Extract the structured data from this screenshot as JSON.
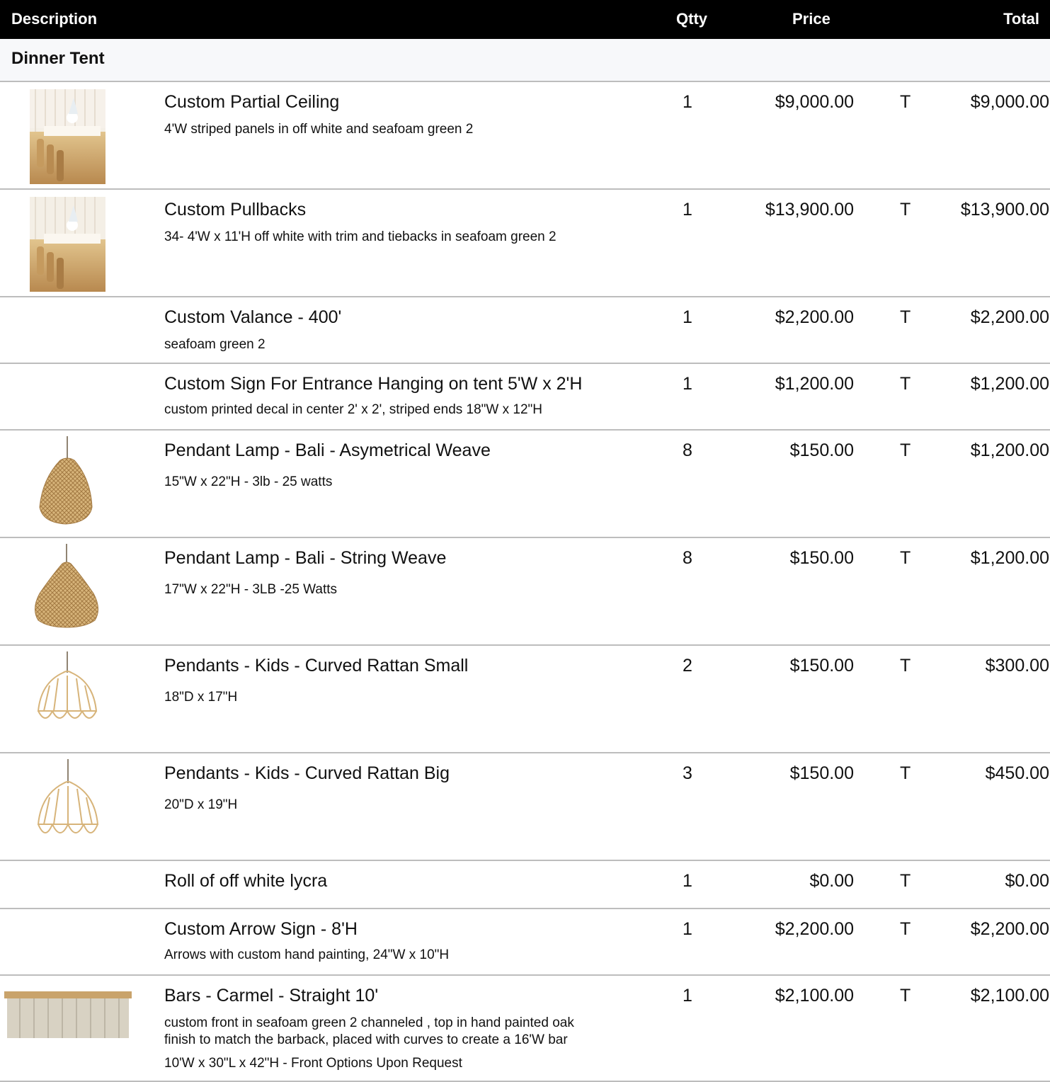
{
  "header": {
    "description": "Description",
    "qty": "Qtty",
    "price": "Price",
    "total": "Total"
  },
  "section": {
    "title": "Dinner Tent"
  },
  "rows": [
    {
      "name": "Custom Partial Ceiling",
      "details": [
        "4'W striped panels in off white and seafoam green 2"
      ],
      "qty": "1",
      "price": "$9,000.00",
      "tax": "T",
      "total": "$9,000.00",
      "image": "tent-interior-photo"
    },
    {
      "name": "Custom Pullbacks",
      "details": [
        "34- 4'W x 11'H off white with trim and tiebacks in seafoam green 2"
      ],
      "qty": "1",
      "price": "$13,900.00",
      "tax": "T",
      "total": "$13,900.00",
      "image": "tent-interior-photo"
    },
    {
      "name": "Custom Valance - 400'",
      "details": [
        "seafoam green 2"
      ],
      "qty": "1",
      "price": "$2,200.00",
      "tax": "T",
      "total": "$2,200.00"
    },
    {
      "name": "Custom Sign For Entrance Hanging on tent 5'W x 2'H",
      "details": [
        "custom printed decal in center 2' x 2', striped ends 18\"W x 12\"H"
      ],
      "qty": "1",
      "price": "$1,200.00",
      "tax": "T",
      "total": "$1,200.00"
    },
    {
      "name": "Pendant Lamp - Bali - Asymetrical Weave",
      "details": [
        "15\"W x 22\"H - 3lb - 25 watts"
      ],
      "qty": "8",
      "price": "$150.00",
      "tax": "T",
      "total": "$1,200.00",
      "image": "rattan-pendant-icon"
    },
    {
      "name": "Pendant Lamp - Bali - String Weave",
      "details": [
        "17\"W x 22\"H - 3LB -25 Watts"
      ],
      "qty": "8",
      "price": "$150.00",
      "tax": "T",
      "total": "$1,200.00",
      "image": "rattan-pendant-icon"
    },
    {
      "name": "Pendants - Kids -  Curved Rattan Small",
      "details": [
        "18\"D x 17\"H"
      ],
      "qty": "2",
      "price": "$150.00",
      "tax": "T",
      "total": "$300.00",
      "image": "scalloped-pendant-icon"
    },
    {
      "name": "Pendants - Kids -  Curved Rattan Big",
      "details": [
        "20\"D x 19\"H"
      ],
      "qty": "3",
      "price": "$150.00",
      "tax": "T",
      "total": "$450.00",
      "image": "scalloped-pendant-icon"
    },
    {
      "name": "Roll of off white lycra",
      "details": [],
      "qty": "1",
      "price": "$0.00",
      "tax": "T",
      "total": "$0.00"
    },
    {
      "name": "Custom Arrow Sign - 8'H",
      "details": [
        "Arrows with custom hand painting, 24\"W x 10\"H"
      ],
      "qty": "1",
      "price": "$2,200.00",
      "tax": "T",
      "total": "$2,200.00"
    },
    {
      "name": "Bars - Carmel - Straight 10'",
      "details": [
        "custom front in seafoam green 2 channeled , top in hand painted oak",
        "finish to match the barback, placed with curves to create a 16'W bar",
        "10'W x 30\"L x 42\"H - Front Options Upon Request"
      ],
      "qty": "1",
      "price": "$2,100.00",
      "tax": "T",
      "total": "$2,100.00",
      "image": "bar-counter-icon"
    }
  ]
}
